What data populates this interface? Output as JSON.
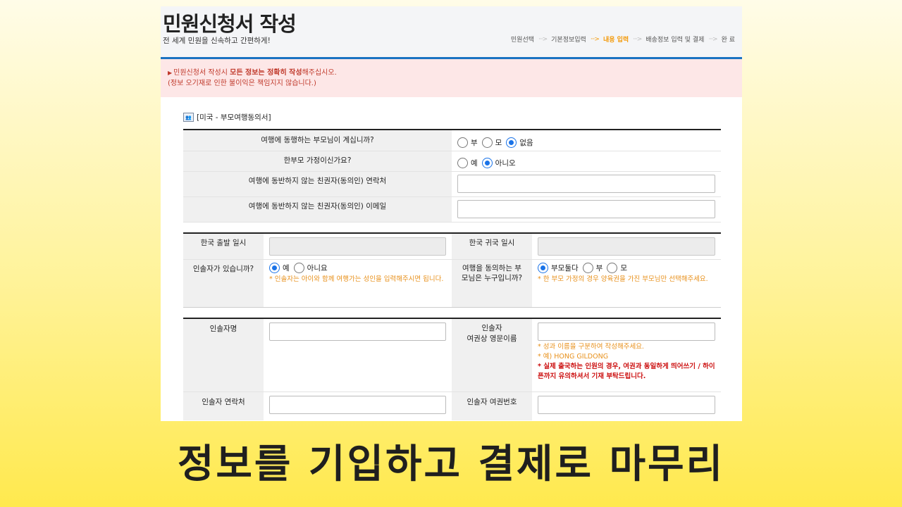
{
  "header": {
    "title": "민원신청서 작성",
    "subtitle": "전 세계 민원을 신속하고 간편하게!",
    "steps": [
      {
        "label": "민원선택",
        "active": false
      },
      {
        "label": "기본정보입력",
        "active": false
      },
      {
        "label": "내용 입력",
        "active": true
      },
      {
        "label": "배송정보 입력 및 결제",
        "active": false
      },
      {
        "label": "완 료",
        "active": false
      }
    ],
    "step_arrow": "···>"
  },
  "notice": {
    "line1_pre": "민원신청서 작성시 ",
    "line1_bold": "모든 정보는 정확히 작성",
    "line1_post": "해주십시오.",
    "line2": "(정보 오기재로 인한 불이익은 책임지지 않습니다.)"
  },
  "section": {
    "title": "[미국 - 부모여행동의서]"
  },
  "q1": {
    "label": "여행에 동행하는 부모님이 계십니까?",
    "options": [
      "부",
      "모",
      "없음"
    ],
    "selected": "없음"
  },
  "q2": {
    "label": "한부모 가정이신가요?",
    "options": [
      "예",
      "아니오"
    ],
    "selected": "아니오"
  },
  "q3": {
    "label": "여행에 동반하지 않는 친권자(동의인) 연락처",
    "value": ""
  },
  "q4": {
    "label": "여행에 동반하지 않는 친권자(동의인) 이메일",
    "value": ""
  },
  "depart": {
    "label": "한국 출발 일시",
    "value": ""
  },
  "return": {
    "label": "한국 귀국 일시",
    "value": ""
  },
  "escort": {
    "label": "인솔자가 있습니까?",
    "options": [
      "예",
      "아니요"
    ],
    "selected": "예",
    "hint": "* 인솔자는 아이와 함께 여행가는 성인을 입력해주시면 됩니다."
  },
  "consent": {
    "label": "여행을 동의하는 부모님은 누구입니까?",
    "options": [
      "부모둘다",
      "부",
      "모"
    ],
    "selected": "부모둘다",
    "hint": "* 한 부모 가정의 경우 양육권을 가진 부모님만 선택해주세요."
  },
  "escort_name": {
    "label": "인솔자명",
    "value": ""
  },
  "escort_eng": {
    "label_line1": "인솔자",
    "label_line2": "여권상 영문이름",
    "value": "",
    "hint1": "* 성과 이름을 구분하여 작성해주세요.",
    "hint2": "* 예) HONG GILDONG",
    "hint3": "* 실제 출국하는 인원의 경우, 여권과 동일하게 띄어쓰기 / 하이픈까지 유의하셔서 기재 부탁드립니다."
  },
  "escort_phone": {
    "label": "인솔자 연락처",
    "value": ""
  },
  "escort_passport": {
    "label": "인솔자 여권번호",
    "value": ""
  },
  "caption": "정보를 기입하고 결제로 마무리",
  "colors": {
    "accent": "#1a73c2",
    "active_step": "#f39a0a",
    "notice_bg": "#fde7e7",
    "hint": "#e8901a",
    "warn": "#cc1010"
  }
}
